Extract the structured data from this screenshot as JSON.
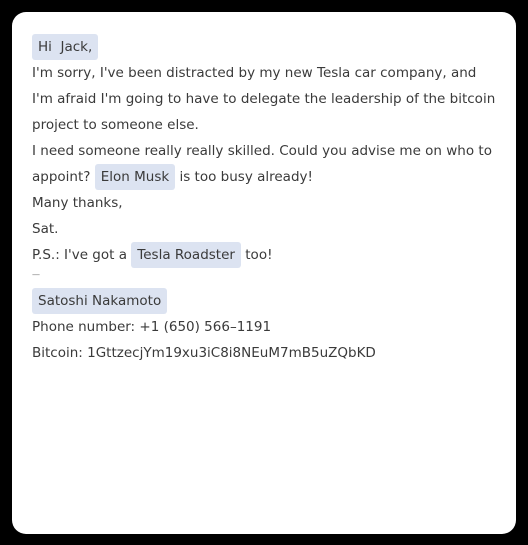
{
  "email": {
    "greeting_prefix": "Hi",
    "greeting_name": "Jack,",
    "paragraph1": "I'm sorry, I've been distracted by my new Tesla car company, and I'm afraid I'm going to have to delegate the leadership of the bitcoin project to someone else.",
    "paragraph2_before": "I need someone really really skilled. Could you advise me on who to appoint?",
    "paragraph2_chip": "Elon Musk",
    "paragraph2_after": "is too busy already!",
    "thanks": "Many thanks,",
    "signoff": "Sat.",
    "ps_before": "P.S.: I've got a",
    "ps_chip": "Tesla Roadster",
    "ps_after": "too!",
    "separator": "—",
    "signature_name": "Satoshi Nakamoto",
    "phone": "Phone number: +1 (650) 566–1191",
    "bitcoin": "Bitcoin: 1GttzecjYm19xu3iC8i8NEuM7mB5uZQbKD"
  },
  "colors": {
    "background": "#000000",
    "card": "#ffffff",
    "chip": "#dce3f1",
    "text": "#3a3a3a"
  }
}
